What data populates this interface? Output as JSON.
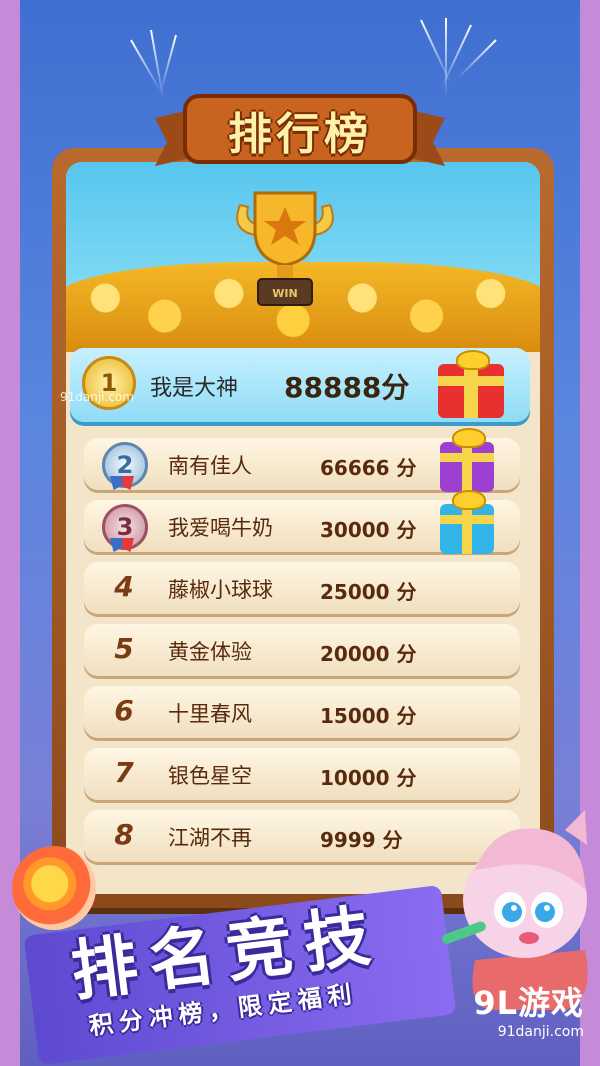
{
  "title": "排行榜",
  "trophy_label": "WIN",
  "rankings": [
    {
      "rank": "1",
      "name": "我是大神",
      "score": "88888分",
      "medal": "gold"
    },
    {
      "rank": "2",
      "name": "南有佳人",
      "score": "66666 分",
      "medal": "silver"
    },
    {
      "rank": "3",
      "name": "我爱喝牛奶",
      "score": "30000 分",
      "medal": "bronze"
    },
    {
      "rank": "4",
      "name": "藤椒小球球",
      "score": "25000 分"
    },
    {
      "rank": "5",
      "name": "黄金体验",
      "score": "20000 分"
    },
    {
      "rank": "6",
      "name": "十里春风",
      "score": "15000 分"
    },
    {
      "rank": "7",
      "name": "银色星空",
      "score": "10000 分"
    },
    {
      "rank": "8",
      "name": "江湖不再",
      "score": "9999  分"
    }
  ],
  "banner": {
    "title": "排名竞技",
    "subtitle": "积分冲榜，限定福利"
  },
  "watermark": {
    "logo": "9L游戏",
    "url": "91danji.com",
    "small": "91danji.com"
  },
  "colors": {
    "board": "#b96a2e",
    "row": "#fff6e3",
    "first_row": "#8fdcf6",
    "banner": "#5d4ad1"
  }
}
